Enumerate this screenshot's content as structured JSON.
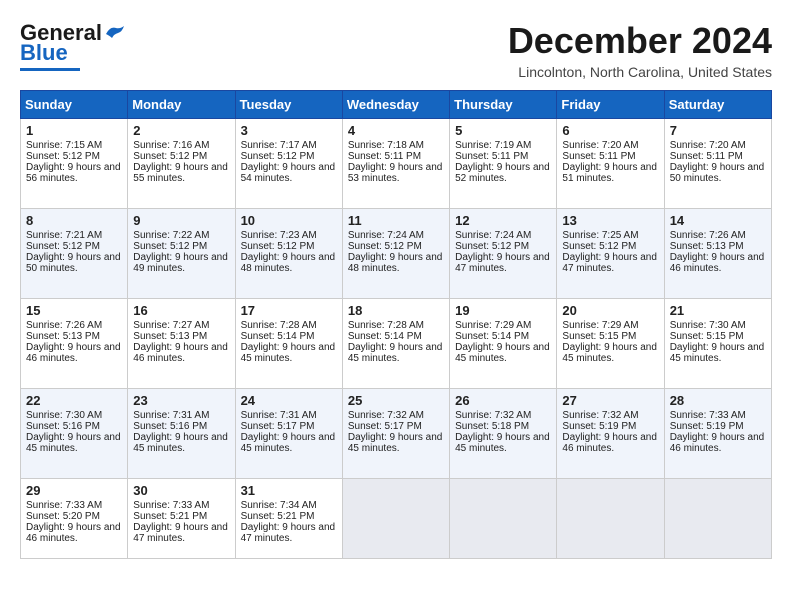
{
  "header": {
    "logo_general": "General",
    "logo_blue": "Blue",
    "month_title": "December 2024",
    "location": "Lincolnton, North Carolina, United States"
  },
  "days_of_week": [
    "Sunday",
    "Monday",
    "Tuesday",
    "Wednesday",
    "Thursday",
    "Friday",
    "Saturday"
  ],
  "weeks": [
    [
      {
        "day": "1",
        "sunrise": "Sunrise: 7:15 AM",
        "sunset": "Sunset: 5:12 PM",
        "daylight": "Daylight: 9 hours and 56 minutes."
      },
      {
        "day": "2",
        "sunrise": "Sunrise: 7:16 AM",
        "sunset": "Sunset: 5:12 PM",
        "daylight": "Daylight: 9 hours and 55 minutes."
      },
      {
        "day": "3",
        "sunrise": "Sunrise: 7:17 AM",
        "sunset": "Sunset: 5:12 PM",
        "daylight": "Daylight: 9 hours and 54 minutes."
      },
      {
        "day": "4",
        "sunrise": "Sunrise: 7:18 AM",
        "sunset": "Sunset: 5:11 PM",
        "daylight": "Daylight: 9 hours and 53 minutes."
      },
      {
        "day": "5",
        "sunrise": "Sunrise: 7:19 AM",
        "sunset": "Sunset: 5:11 PM",
        "daylight": "Daylight: 9 hours and 52 minutes."
      },
      {
        "day": "6",
        "sunrise": "Sunrise: 7:20 AM",
        "sunset": "Sunset: 5:11 PM",
        "daylight": "Daylight: 9 hours and 51 minutes."
      },
      {
        "day": "7",
        "sunrise": "Sunrise: 7:20 AM",
        "sunset": "Sunset: 5:11 PM",
        "daylight": "Daylight: 9 hours and 50 minutes."
      }
    ],
    [
      {
        "day": "8",
        "sunrise": "Sunrise: 7:21 AM",
        "sunset": "Sunset: 5:12 PM",
        "daylight": "Daylight: 9 hours and 50 minutes."
      },
      {
        "day": "9",
        "sunrise": "Sunrise: 7:22 AM",
        "sunset": "Sunset: 5:12 PM",
        "daylight": "Daylight: 9 hours and 49 minutes."
      },
      {
        "day": "10",
        "sunrise": "Sunrise: 7:23 AM",
        "sunset": "Sunset: 5:12 PM",
        "daylight": "Daylight: 9 hours and 48 minutes."
      },
      {
        "day": "11",
        "sunrise": "Sunrise: 7:24 AM",
        "sunset": "Sunset: 5:12 PM",
        "daylight": "Daylight: 9 hours and 48 minutes."
      },
      {
        "day": "12",
        "sunrise": "Sunrise: 7:24 AM",
        "sunset": "Sunset: 5:12 PM",
        "daylight": "Daylight: 9 hours and 47 minutes."
      },
      {
        "day": "13",
        "sunrise": "Sunrise: 7:25 AM",
        "sunset": "Sunset: 5:12 PM",
        "daylight": "Daylight: 9 hours and 47 minutes."
      },
      {
        "day": "14",
        "sunrise": "Sunrise: 7:26 AM",
        "sunset": "Sunset: 5:13 PM",
        "daylight": "Daylight: 9 hours and 46 minutes."
      }
    ],
    [
      {
        "day": "15",
        "sunrise": "Sunrise: 7:26 AM",
        "sunset": "Sunset: 5:13 PM",
        "daylight": "Daylight: 9 hours and 46 minutes."
      },
      {
        "day": "16",
        "sunrise": "Sunrise: 7:27 AM",
        "sunset": "Sunset: 5:13 PM",
        "daylight": "Daylight: 9 hours and 46 minutes."
      },
      {
        "day": "17",
        "sunrise": "Sunrise: 7:28 AM",
        "sunset": "Sunset: 5:14 PM",
        "daylight": "Daylight: 9 hours and 45 minutes."
      },
      {
        "day": "18",
        "sunrise": "Sunrise: 7:28 AM",
        "sunset": "Sunset: 5:14 PM",
        "daylight": "Daylight: 9 hours and 45 minutes."
      },
      {
        "day": "19",
        "sunrise": "Sunrise: 7:29 AM",
        "sunset": "Sunset: 5:14 PM",
        "daylight": "Daylight: 9 hours and 45 minutes."
      },
      {
        "day": "20",
        "sunrise": "Sunrise: 7:29 AM",
        "sunset": "Sunset: 5:15 PM",
        "daylight": "Daylight: 9 hours and 45 minutes."
      },
      {
        "day": "21",
        "sunrise": "Sunrise: 7:30 AM",
        "sunset": "Sunset: 5:15 PM",
        "daylight": "Daylight: 9 hours and 45 minutes."
      }
    ],
    [
      {
        "day": "22",
        "sunrise": "Sunrise: 7:30 AM",
        "sunset": "Sunset: 5:16 PM",
        "daylight": "Daylight: 9 hours and 45 minutes."
      },
      {
        "day": "23",
        "sunrise": "Sunrise: 7:31 AM",
        "sunset": "Sunset: 5:16 PM",
        "daylight": "Daylight: 9 hours and 45 minutes."
      },
      {
        "day": "24",
        "sunrise": "Sunrise: 7:31 AM",
        "sunset": "Sunset: 5:17 PM",
        "daylight": "Daylight: 9 hours and 45 minutes."
      },
      {
        "day": "25",
        "sunrise": "Sunrise: 7:32 AM",
        "sunset": "Sunset: 5:17 PM",
        "daylight": "Daylight: 9 hours and 45 minutes."
      },
      {
        "day": "26",
        "sunrise": "Sunrise: 7:32 AM",
        "sunset": "Sunset: 5:18 PM",
        "daylight": "Daylight: 9 hours and 45 minutes."
      },
      {
        "day": "27",
        "sunrise": "Sunrise: 7:32 AM",
        "sunset": "Sunset: 5:19 PM",
        "daylight": "Daylight: 9 hours and 46 minutes."
      },
      {
        "day": "28",
        "sunrise": "Sunrise: 7:33 AM",
        "sunset": "Sunset: 5:19 PM",
        "daylight": "Daylight: 9 hours and 46 minutes."
      }
    ],
    [
      {
        "day": "29",
        "sunrise": "Sunrise: 7:33 AM",
        "sunset": "Sunset: 5:20 PM",
        "daylight": "Daylight: 9 hours and 46 minutes."
      },
      {
        "day": "30",
        "sunrise": "Sunrise: 7:33 AM",
        "sunset": "Sunset: 5:21 PM",
        "daylight": "Daylight: 9 hours and 47 minutes."
      },
      {
        "day": "31",
        "sunrise": "Sunrise: 7:34 AM",
        "sunset": "Sunset: 5:21 PM",
        "daylight": "Daylight: 9 hours and 47 minutes."
      },
      null,
      null,
      null,
      null
    ]
  ]
}
